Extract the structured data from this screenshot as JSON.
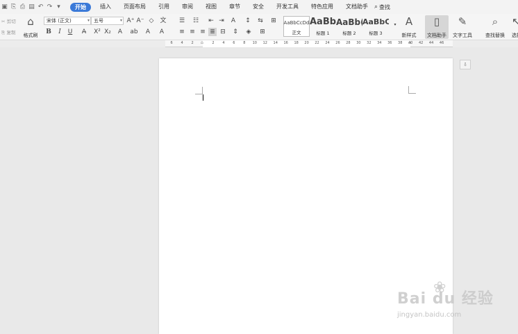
{
  "menu": {
    "quick_access": [
      {
        "icon": "save-icon",
        "glyph": "▣"
      },
      {
        "icon": "export-pdf-icon",
        "glyph": "⎘"
      },
      {
        "icon": "print-icon",
        "glyph": "⎙"
      },
      {
        "icon": "print-preview-icon",
        "glyph": "▤"
      },
      {
        "icon": "undo-icon",
        "glyph": "↶"
      },
      {
        "icon": "redo-icon",
        "glyph": "↷"
      },
      {
        "icon": "customize-icon",
        "glyph": "▾"
      }
    ],
    "tabs": [
      "开始",
      "插入",
      "页面布局",
      "引用",
      "审阅",
      "视图",
      "章节",
      "安全",
      "开发工具",
      "特色应用",
      "文档助手"
    ],
    "active_tab": "开始",
    "search_label": "查找"
  },
  "ribbon": {
    "cut_label": "剪切",
    "copy_label": "复制",
    "format_painter_label": "格式刷",
    "font_name": "宋体 (正文)",
    "font_size": "五号",
    "styles": [
      {
        "sample": "AaBbCcDd",
        "name": "正文"
      },
      {
        "sample": "AaBb",
        "name": "标题 1"
      },
      {
        "sample": "AaBb(",
        "name": "标题 2"
      },
      {
        "sample": "AaBbC",
        "name": "标题 3"
      }
    ],
    "new_style_label": "新样式",
    "doc_assistant_label": "文档助手",
    "text_tools_label": "文字工具",
    "find_replace_label": "查找替换",
    "select_label": "选择"
  },
  "ruler": {
    "ticks": [
      "6",
      "4",
      "2",
      "2",
      "4",
      "6",
      "8",
      "10",
      "12",
      "14",
      "16",
      "18",
      "20",
      "22",
      "24",
      "26",
      "28",
      "30",
      "32",
      "34",
      "36",
      "38",
      "40",
      "42",
      "44",
      "46"
    ]
  },
  "watermark": {
    "logo": "Bai du 经验",
    "url": "jingyan.baidu.com"
  },
  "colors": {
    "accent": "#3a79d8",
    "background": "#e9e9e9",
    "page": "#ffffff"
  }
}
